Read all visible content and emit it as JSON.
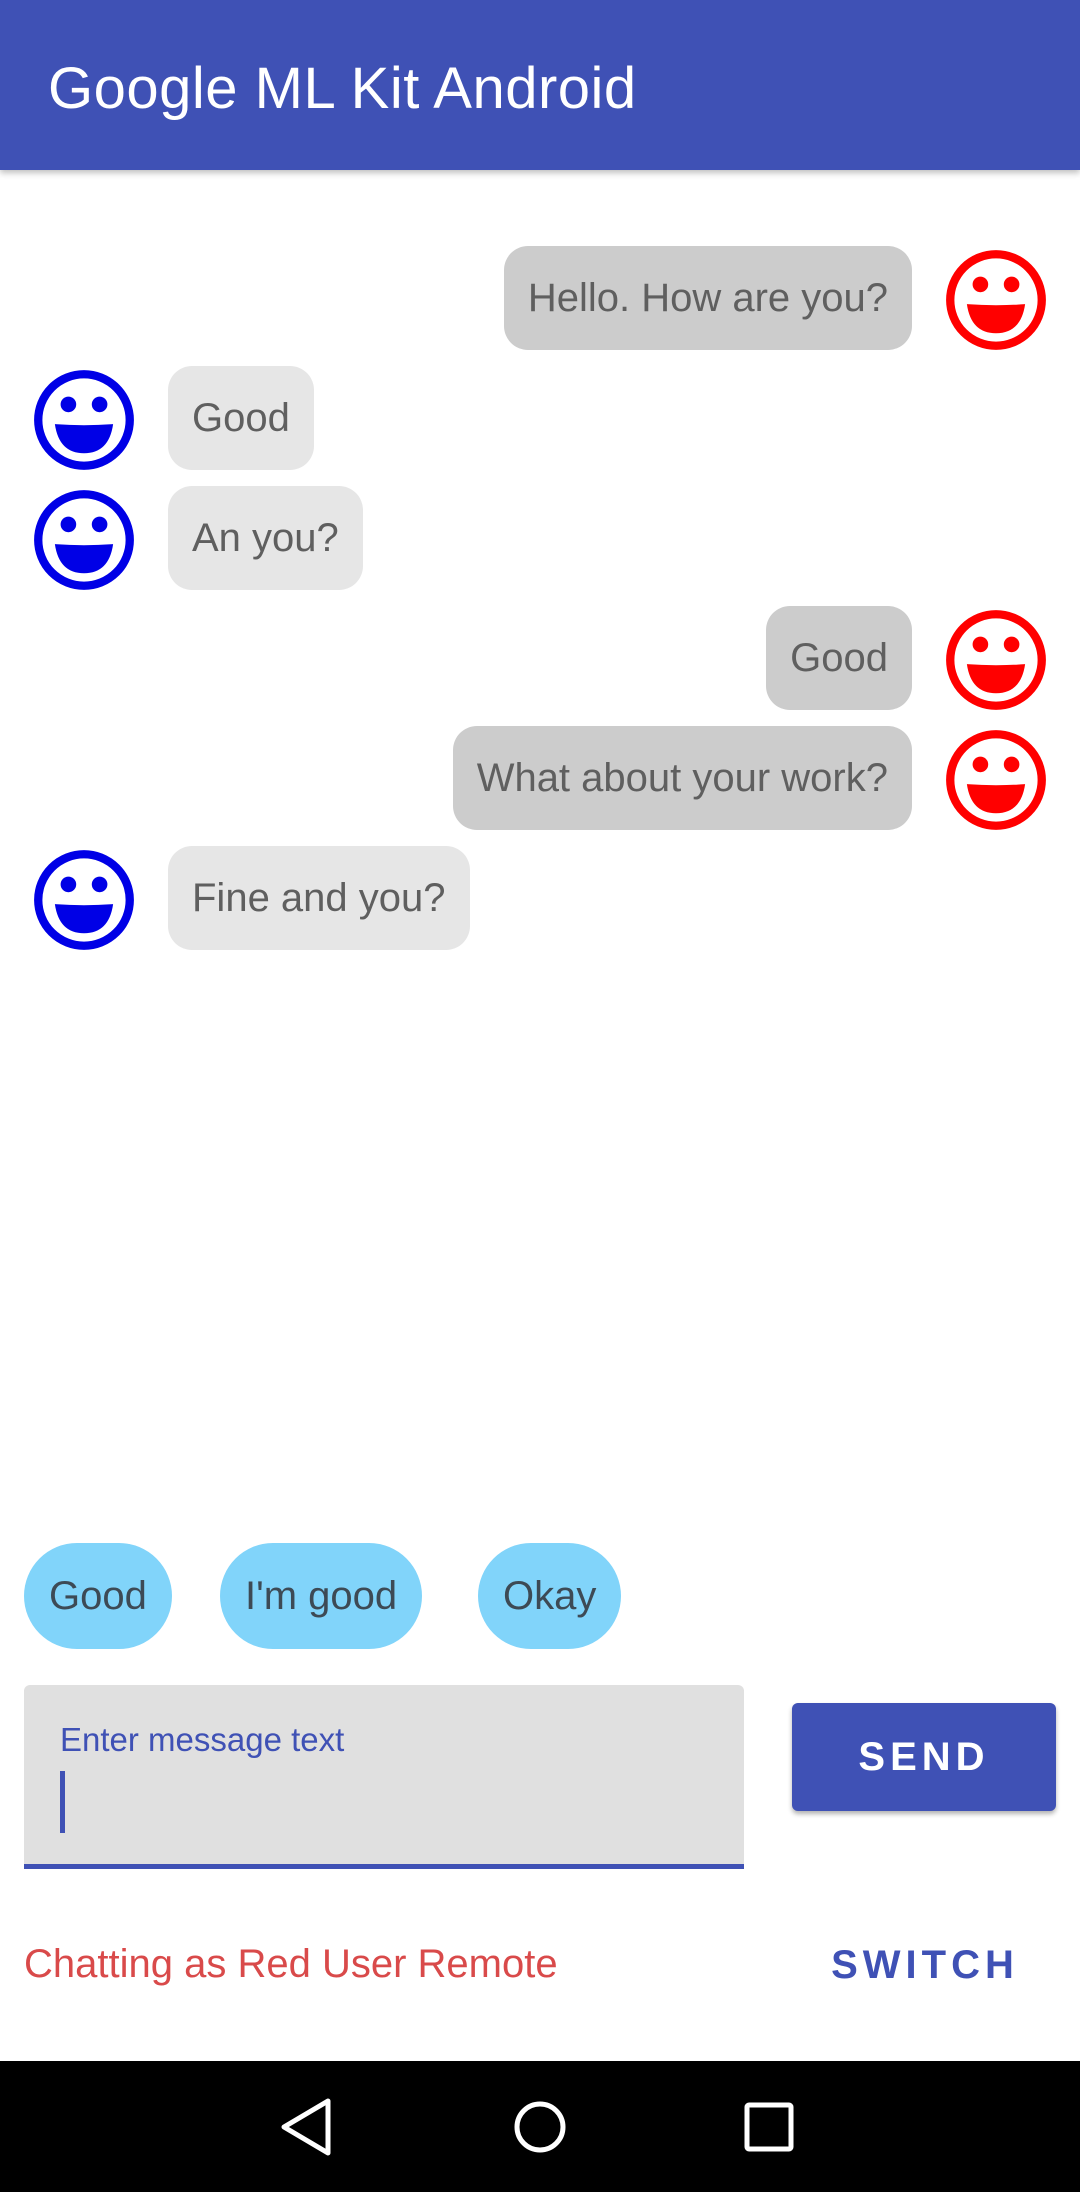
{
  "app_bar": {
    "title": "Google ML Kit Android"
  },
  "messages": [
    {
      "side": "red",
      "text": "Hello. How are you?"
    },
    {
      "side": "blue",
      "text": "Good"
    },
    {
      "side": "blue",
      "text": "An you?"
    },
    {
      "side": "red",
      "text": "Good"
    },
    {
      "side": "red",
      "text": "What about your work?"
    },
    {
      "side": "blue",
      "text": "Fine and you?"
    }
  ],
  "suggestions": [
    "Good",
    "I'm good",
    "Okay"
  ],
  "composer": {
    "label": "Enter message text",
    "value": "",
    "send_label": "SEND"
  },
  "footer": {
    "status": "Chatting as Red User Remote",
    "switch_label": "SWITCH"
  },
  "colors": {
    "primary": "#3f51b5",
    "red_user": "#ff0000",
    "blue_user": "#0000e6",
    "chip": "#81d4fa",
    "status_text": "#d94a4a"
  },
  "icons": {
    "red_avatar": "smiley-face-icon",
    "blue_avatar": "smiley-face-icon",
    "nav": [
      "back-triangle-icon",
      "home-circle-icon",
      "recents-square-icon"
    ]
  }
}
